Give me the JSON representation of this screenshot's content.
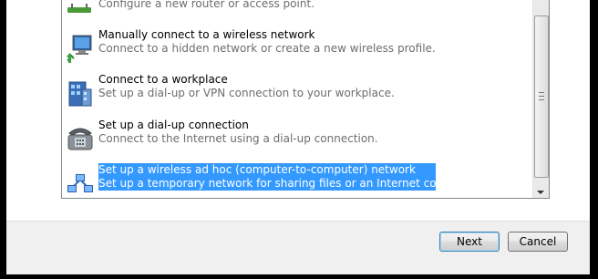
{
  "options": [
    {
      "title": "",
      "description": "Configure a new router or access point.",
      "icon": "router-icon"
    },
    {
      "title": "Manually connect to a wireless network",
      "description": "Connect to a hidden network or create a new wireless profile.",
      "icon": "wireless-monitor-icon"
    },
    {
      "title": "Connect to a workplace",
      "description": "Set up a dial-up or VPN connection to your workplace.",
      "icon": "workplace-building-icon"
    },
    {
      "title": "Set up a dial-up connection",
      "description": "Connect to the Internet using a dial-up connection.",
      "icon": "dialup-phone-icon"
    },
    {
      "title": "Set up a wireless ad hoc (computer-to-computer) network",
      "description": "Set up a temporary network for sharing files or an Internet connection.",
      "icon": "adhoc-network-icon",
      "selected": true
    }
  ],
  "buttons": {
    "next": "Next",
    "cancel": "Cancel"
  },
  "colors": {
    "selection": "#3399ff",
    "accent_border": "#3c7fb1"
  }
}
